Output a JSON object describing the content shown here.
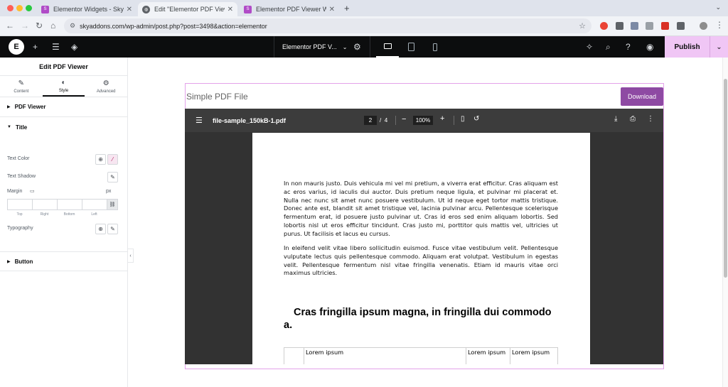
{
  "browser": {
    "tabs": [
      {
        "title": "Elementor Widgets - Sky Add",
        "active": false
      },
      {
        "title": "Edit \"Elementor PDF Viewer V",
        "active": true
      },
      {
        "title": "Elementor PDF Viewer Widge",
        "active": false
      }
    ],
    "url": "skyaddons.com/wp-admin/post.php?post=3498&action=elementor"
  },
  "editor_bar": {
    "logo": "E",
    "document_title": "Elementor PDF V...",
    "publish_label": "Publish",
    "active_device": "desktop",
    "accent_color": "#f0c6f5"
  },
  "panel": {
    "title": "Edit PDF Viewer",
    "tabs": [
      {
        "label": "Content",
        "icon": "pencil-icon"
      },
      {
        "label": "Style",
        "icon": "contrast-icon"
      },
      {
        "label": "Advanced",
        "icon": "gear-icon"
      }
    ],
    "active_tab": "Style",
    "sections": {
      "pdf_viewer": "PDF Viewer",
      "title": "Title",
      "button": "Button"
    },
    "controls": {
      "text_color": "Text Color",
      "text_shadow": "Text Shadow",
      "margin": "Margin",
      "margin_unit": "px",
      "typography": "Typography",
      "dimension_labels": [
        "Top",
        "Right",
        "Bottom",
        "Left"
      ]
    }
  },
  "widget": {
    "title": "Simple PDF File",
    "download_label": "Download",
    "download_color": "#8e4aa3",
    "viewer": {
      "file_name": "file-sample_150kB-1.pdf",
      "current_page": "2",
      "page_separator": "/",
      "total_pages": "4",
      "zoom": "100%"
    },
    "page_content": {
      "paragraph1": "In non mauris justo. Duis vehicula mi vel mi pretium, a viverra erat efficitur. Cras aliquam est ac eros varius, id iaculis dui auctor. Duis pretium neque ligula, et pulvinar mi placerat et. Nulla nec nunc sit amet nunc posuere vestibulum. Ut id neque eget tortor mattis tristique. Donec ante est, blandit sit amet tristique vel, lacinia pulvinar arcu. Pellentesque scelerisque fermentum erat, id posuere justo pulvinar ut. Cras id eros sed enim aliquam lobortis. Sed lobortis nisl ut eros efficitur tincidunt. Cras justo mi, porttitor quis mattis vel, ultricies ut purus. Ut facilisis et lacus eu cursus.",
      "paragraph2": "In eleifend velit vitae libero sollicitudin euismod. Fusce vitae vestibulum velit. Pellentesque vulputate lectus quis pellentesque commodo. Aliquam erat volutpat. Vestibulum in egestas velit. Pellentesque fermentum nisl vitae fringilla venenatis. Etiam id mauris vitae orci maximus ultricies.",
      "heading": "Cras fringilla ipsum magna, in fringilla dui commodo a.",
      "table_headers": [
        "",
        "Lorem ipsum",
        "Lorem ipsum",
        "Lorem ipsum"
      ]
    }
  }
}
